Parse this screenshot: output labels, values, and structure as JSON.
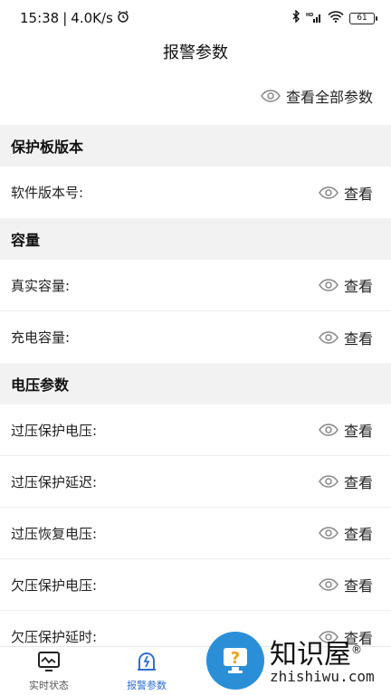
{
  "status_bar": {
    "time": "15:38",
    "speed": "4.0K/s",
    "battery": "61"
  },
  "title": "报警参数",
  "view_all_label": "查看全部参数",
  "view_label": "查看",
  "sections": [
    {
      "header": "保护板版本",
      "rows": [
        "软件版本号:"
      ]
    },
    {
      "header": "容量",
      "rows": [
        "真实容量:",
        "充电容量:"
      ]
    },
    {
      "header": "电压参数",
      "rows": [
        "过压保护电压:",
        "过压保护延迟:",
        "过压恢复电压:",
        "欠压保护电压:",
        "欠压保护延时:"
      ]
    }
  ],
  "bottom_nav": [
    {
      "label": "实时状态",
      "icon": "monitor-icon",
      "active": false
    },
    {
      "label": "报警参数",
      "icon": "alarm-icon",
      "active": true
    },
    {
      "label": "",
      "icon": "",
      "active": false
    },
    {
      "label": "",
      "icon": "",
      "active": false
    }
  ],
  "watermark": {
    "text": "知识屋",
    "sub": "zhishiwu.com",
    "reg": "®"
  },
  "colors": {
    "accent": "#2f6fd6",
    "section_bg": "#f2f2f2",
    "watermark_blue": "#2b8fd8"
  }
}
